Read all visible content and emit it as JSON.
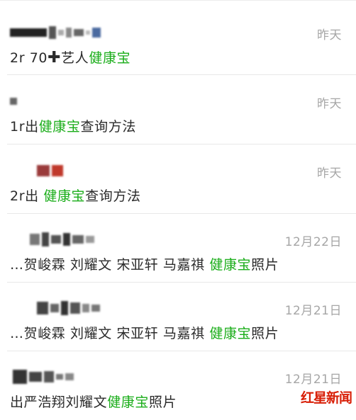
{
  "chats": [
    {
      "date": "昨天",
      "pre": "2r 70",
      "plus": "✚",
      "mid": "艺人",
      "highlight": "健康宝",
      "post": ""
    },
    {
      "date": "昨天",
      "pre": "1r出",
      "plus": "",
      "mid": "",
      "highlight": "健康宝",
      "post": "查询方法"
    },
    {
      "date": "昨天",
      "pre": "2r出 ",
      "plus": "",
      "mid": "",
      "highlight": "健康宝",
      "post": "查询方法"
    },
    {
      "date": "12月22日",
      "pre": "…贺峻霖 刘耀文 宋亚轩 马嘉祺  ",
      "plus": "",
      "mid": "",
      "highlight": "健康宝",
      "post": "照片"
    },
    {
      "date": "12月21日",
      "pre": "…贺峻霖 刘耀文 宋亚轩 马嘉祺 ",
      "plus": "",
      "mid": "",
      "highlight": "健康宝",
      "post": "照片"
    },
    {
      "date": "12月21日",
      "pre": "出严浩翔刘耀文",
      "plus": "",
      "mid": "",
      "highlight": "健康宝",
      "post": "照片"
    }
  ],
  "watermark": {
    "text": "红星新闻"
  },
  "colors": {
    "highlight": "#1aad19",
    "date": "#a6a6a6",
    "watermark": "#d81e06"
  }
}
